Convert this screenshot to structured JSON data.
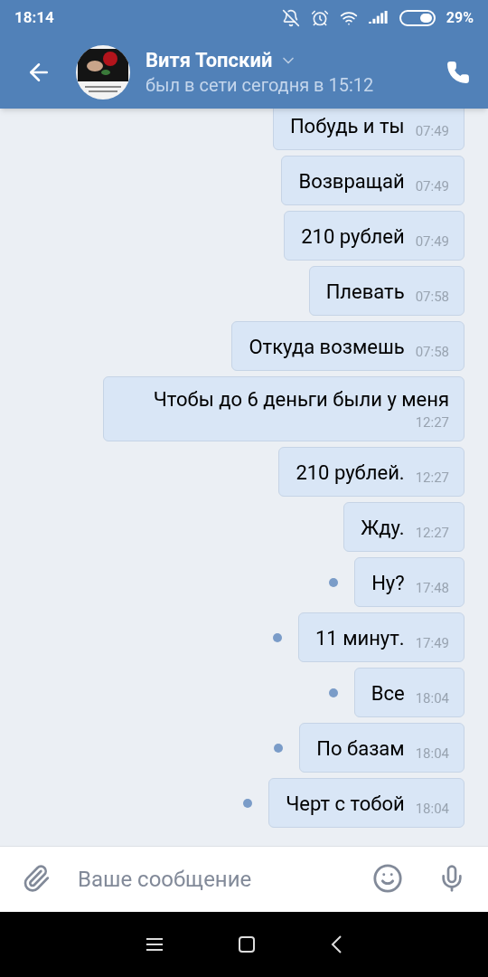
{
  "status_bar": {
    "time": "18:14",
    "battery": "29%"
  },
  "header": {
    "name": "Витя Топский",
    "status": "был в сети сегодня в 15:12"
  },
  "messages": [
    {
      "text": "Побудь и ты",
      "time": "07:49",
      "unread": false
    },
    {
      "text": "Возвращай",
      "time": "07:49",
      "unread": false
    },
    {
      "text": "210 рублей",
      "time": "07:49",
      "unread": false
    },
    {
      "text": "Плевать",
      "time": "07:58",
      "unread": false
    },
    {
      "text": "Откуда возмешь",
      "time": "07:58",
      "unread": false
    },
    {
      "text": "Чтобы до 6 деньги были у меня",
      "time": "12:27",
      "unread": false
    },
    {
      "text": "210 рублей.",
      "time": "12:27",
      "unread": false
    },
    {
      "text": "Жду.",
      "time": "12:27",
      "unread": false
    },
    {
      "text": "Ну?",
      "time": "17:48",
      "unread": true
    },
    {
      "text": "11 минут.",
      "time": "17:49",
      "unread": true
    },
    {
      "text": "Все",
      "time": "18:04",
      "unread": true
    },
    {
      "text": "По базам",
      "time": "18:04",
      "unread": true
    },
    {
      "text": "Черт с тобой",
      "time": "18:04",
      "unread": true
    }
  ],
  "composer": {
    "placeholder": "Ваше сообщение"
  }
}
